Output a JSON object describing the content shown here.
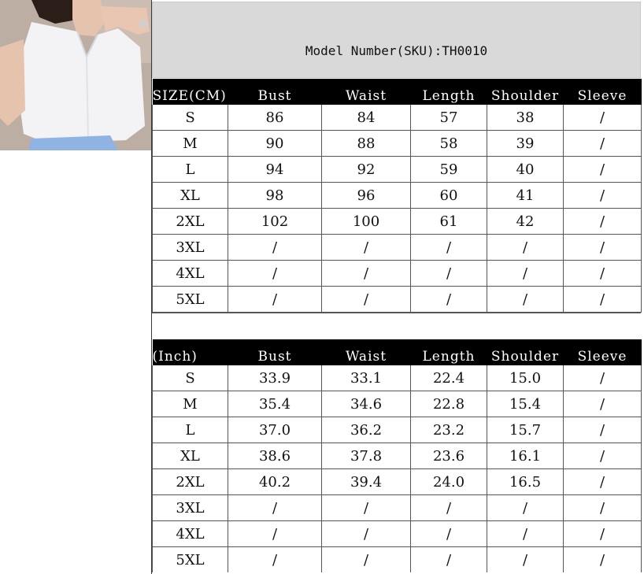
{
  "header": {
    "model_label": "Model Number(SKU):TH0010"
  },
  "cm_table": {
    "columns": [
      "SIZE(CM)",
      "Bust",
      "Waist",
      "Length",
      "Shoulder",
      "Sleeve"
    ],
    "rows": [
      [
        "S",
        "86",
        "84",
        "57",
        "38",
        "/"
      ],
      [
        "M",
        "90",
        "88",
        "58",
        "39",
        "/"
      ],
      [
        "L",
        "94",
        "92",
        "59",
        "40",
        "/"
      ],
      [
        "XL",
        "98",
        "96",
        "60",
        "41",
        "/"
      ],
      [
        "2XL",
        "102",
        "100",
        "61",
        "42",
        "/"
      ],
      [
        "3XL",
        "/",
        "/",
        "/",
        "/",
        "/"
      ],
      [
        "4XL",
        "/",
        "/",
        "/",
        "/",
        "/"
      ],
      [
        "5XL",
        "/",
        "/",
        "/",
        "/",
        "/"
      ]
    ]
  },
  "inch_table": {
    "columns": [
      "(Inch)",
      "Bust",
      "Waist",
      "Length",
      "Shoulder",
      "Sleeve"
    ],
    "rows": [
      [
        "S",
        "33.9",
        "33.1",
        "22.4",
        "15.0",
        "/"
      ],
      [
        "M",
        "35.4",
        "34.6",
        "22.8",
        "15.4",
        "/"
      ],
      [
        "L",
        "37.0",
        "36.2",
        "23.2",
        "15.7",
        "/"
      ],
      [
        "XL",
        "38.6",
        "37.8",
        "23.6",
        "16.1",
        "/"
      ],
      [
        "2XL",
        "40.2",
        "39.4",
        "24.0",
        "16.5",
        "/"
      ],
      [
        "3XL",
        "/",
        "/",
        "/",
        "/",
        "/"
      ],
      [
        "4XL",
        "/",
        "/",
        "/",
        "/",
        "/"
      ],
      [
        "5XL",
        "/",
        "/",
        "/",
        "/",
        "/"
      ]
    ]
  },
  "product_photo": {
    "icon": "model-photo",
    "description_colors": {
      "top": "#f4f4f6",
      "skin": "#e9c9b4",
      "pants": "#8fb4e3"
    }
  }
}
